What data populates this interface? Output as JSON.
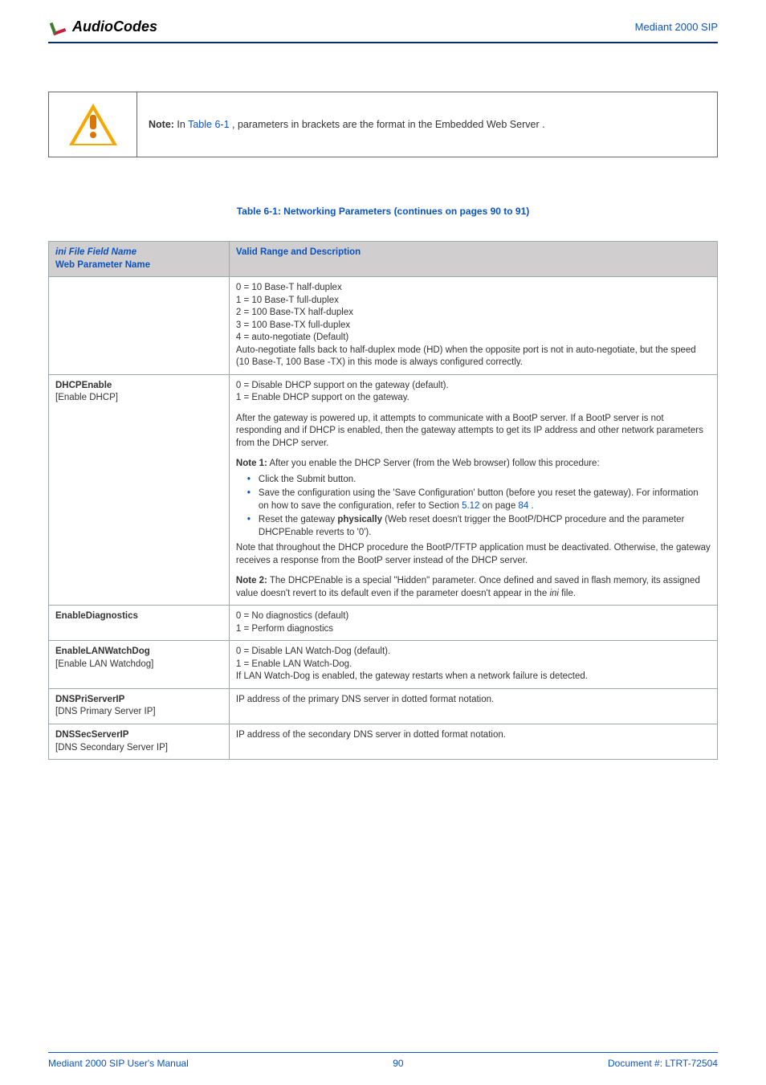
{
  "header": {
    "logo_text": "AudioCodes",
    "right_text": "Mediant 2000 SIP"
  },
  "note": {
    "prefix": "Note: ",
    "run1": "In ",
    "link": "Table 6-1",
    "run2": ", parameters in brackets are the format in the Embedded Web Server .",
    "warn_name": "warning-icon"
  },
  "table": {
    "caption_prefix": "Table 6-1: Networking Parameters ",
    "caption_suffix": "(continues on pages 90 to 91)",
    "col_key": "ini File Field Name",
    "col_key2": "Web Parameter Name",
    "col_val": "Valid Range and Description"
  },
  "rows": [
    {
      "key_ini": "",
      "key_web": "",
      "val_html_id": "cell-speed"
    },
    {
      "key_ini": "DHCPEnable",
      "key_web": "[Enable DHCP]",
      "val_html_id": "cell-dhcp"
    },
    {
      "key_ini": "EnableDiagnostics",
      "key_web": "",
      "val_html_id": "cell-diag"
    },
    {
      "key_ini": "EnableLANWatchDog",
      "key_web": "[Enable LAN Watchdog]",
      "val_html_id": "cell-lanwd"
    },
    {
      "key_ini": "DNSPriServerIP",
      "key_web": "[DNS Primary Server IP]",
      "val_html_id": "cell-dns1"
    },
    {
      "key_ini": "DNSSecServerIP",
      "key_web": "[DNS Secondary Server IP]",
      "val_html_id": "cell-dns2"
    }
  ],
  "cells": {
    "speed": {
      "l0": "0 = 10 Base-T half-duplex",
      "l1": "1 = 10 Base-T full-duplex",
      "l2": "2 = 100 Base-TX half-duplex",
      "l3": "3 = 100 Base-TX full-duplex",
      "l4": "4 = auto-negotiate (Default)",
      "l5": "Auto-negotiate falls back to half-duplex mode (HD) when the opposite port is not in auto-negotiate, but the speed (10 Base-T, 100 Base -TX) in this mode is always configured correctly."
    },
    "dhcp": {
      "l0": "0 = Disable DHCP support on the gateway (default).",
      "l1": "1 = Enable DHCP support on the gateway.",
      "p1": "After the gateway is powered up, it attempts to communicate with a BootP server. If a BootP server is not responding and if DHCP is enabled, then the gateway attempts to get its IP address and other network parameters from the DHCP server.",
      "note1_b": "Note 1:",
      "note1_t": " After you enable the DHCP Server (from the Web browser) follow this procedure:",
      "b1": "Click the Submit button.",
      "b2a": "Save the configuration using the 'Save Configuration' button (before you reset the gateway). For information on how to save the configuration, refer to Section ",
      "b2link": "5.12",
      "b2mid": " on page ",
      "b2page": "84",
      "b2end": ".",
      "b3a": "Reset the gateway ",
      "b3b": "physically ",
      "b3c": "(Web reset doesn't trigger the BootP/DHCP procedure and the parameter DHCPEnable reverts to '0').",
      "p2": "Note that throughout the DHCP procedure the BootP/TFTP application must be deactivated. Otherwise, the gateway receives a response from the BootP server instead of the DHCP server.",
      "note2_b": "Note 2:",
      "note2_t": " The DHCPEnable is a special \"Hidden\" parameter. Once defined and saved in flash memory, its assigned value doesn't revert to its default even if the parameter doesn't appear in the ",
      "note2_ini": "ini ",
      "note2_end": "file."
    },
    "diag": {
      "l0": "0 = No diagnostics (default)",
      "l1": "1 = Perform diagnostics"
    },
    "lanwd": {
      "l0": "0 = Disable LAN Watch-Dog (default).",
      "l1": "1 = Enable LAN Watch-Dog.",
      "l2": "If LAN Watch-Dog is enabled, the gateway restarts when a network failure is detected."
    },
    "dns1": {
      "t": "IP address of the primary DNS server in dotted format notation."
    },
    "dns2": {
      "t": "IP address of the secondary DNS server in dotted format notation."
    }
  },
  "footer": {
    "left": "Mediant 2000 SIP User's Manual",
    "center": "90",
    "right": "Document #: LTRT-72504"
  }
}
